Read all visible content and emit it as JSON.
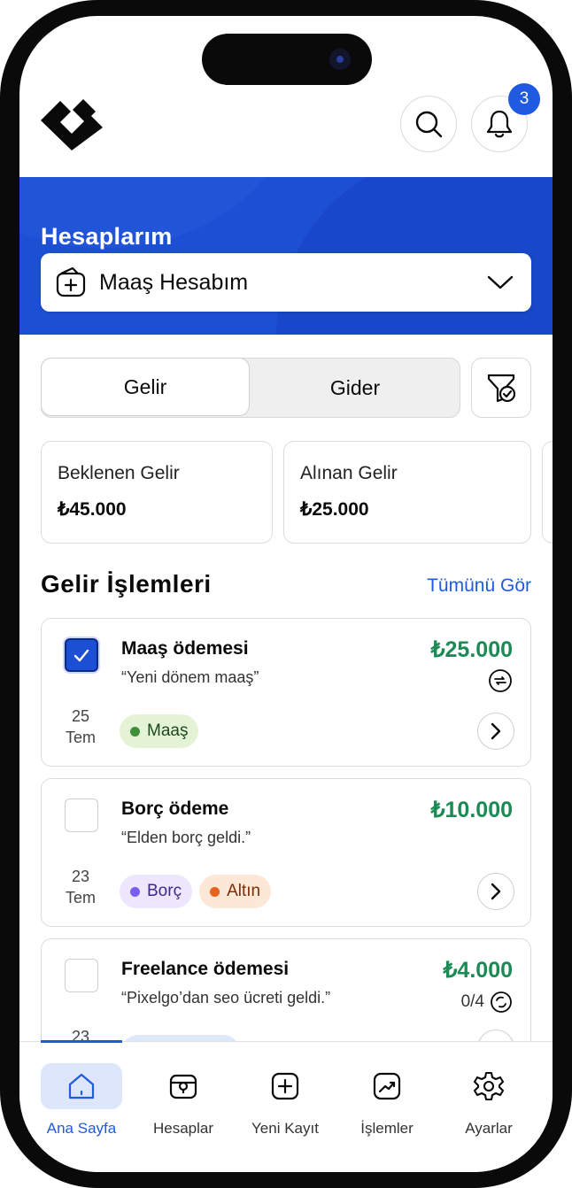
{
  "header": {
    "notification_count": "3"
  },
  "hero": {
    "title": "Hesaplarım",
    "selected_account": "Maaş Hesabım"
  },
  "segment": {
    "options": [
      "Gelir",
      "Gider"
    ],
    "active": "Gelir"
  },
  "stats": [
    {
      "label": "Beklenen Gelir",
      "value": "₺45.000"
    },
    {
      "label": "Alınan Gelir",
      "value": "₺25.000"
    }
  ],
  "section": {
    "title": "Gelir İşlemleri",
    "see_all": "Tümünü Gör"
  },
  "transactions": [
    {
      "name": "Maaş ödemesi",
      "desc": "“Yeni dönem maaş”",
      "amount": "₺25.000",
      "day": "25",
      "month": "Tem",
      "checked": true,
      "tags": [
        {
          "label": "Maaş",
          "color": "#3f8f3a",
          "bg": "#e4f3d6"
        }
      ]
    },
    {
      "name": "Borç ödeme",
      "desc": "“Elden borç geldi.”",
      "amount": "₺10.000",
      "day": "23",
      "month": "Tem",
      "checked": false,
      "tags": [
        {
          "label": "Borç",
          "color": "#7a5cf0",
          "bg": "#ece7fd"
        },
        {
          "label": "Altın",
          "color": "#e8621c",
          "bg": "#fde7d6"
        }
      ]
    },
    {
      "name": "Freelance ödemesi",
      "desc": "“Pixelgo’dan seo ücreti geldi.”",
      "amount": "₺4.000",
      "day": "23",
      "month": "",
      "checked": false,
      "recurrence": "0/4",
      "tags": []
    }
  ],
  "nav": [
    {
      "label": "Ana Sayfa",
      "icon": "home-icon",
      "active": true
    },
    {
      "label": "Hesaplar",
      "icon": "wallet-icon",
      "active": false
    },
    {
      "label": "Yeni Kayıt",
      "icon": "plus-square-icon",
      "active": false
    },
    {
      "label": "İşlemler",
      "icon": "trend-icon",
      "active": false
    },
    {
      "label": "Ayarlar",
      "icon": "gear-icon",
      "active": false
    }
  ],
  "colors": {
    "primary": "#1d4fd4",
    "positive": "#1c8a55"
  }
}
